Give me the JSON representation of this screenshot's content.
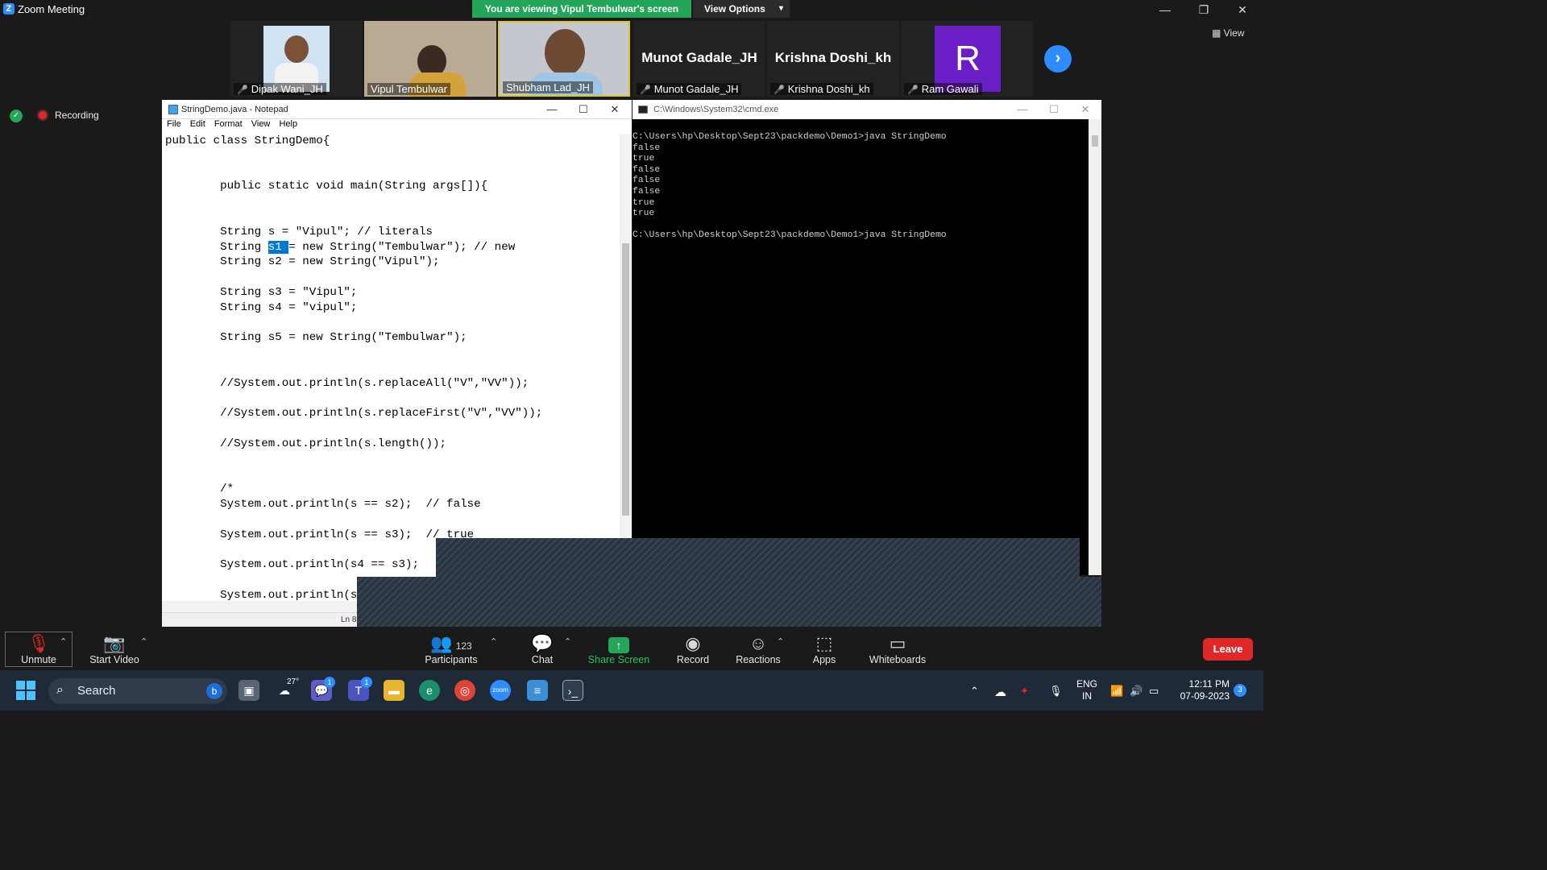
{
  "window": {
    "title": "Zoom Meeting",
    "banner": "You are viewing Vipul Tembulwar's screen",
    "view_options": "View Options",
    "view_btn": "View"
  },
  "participants_strip": [
    {
      "name": "Dipak Wani_JH",
      "muted": true
    },
    {
      "name": "Vipul Tembulwar",
      "muted": false
    },
    {
      "name": "Shubham Lad_JH",
      "muted": false
    },
    {
      "name": "Munot Gadale_JH",
      "muted": true
    },
    {
      "name": "Krishna Doshi_kh",
      "muted": true
    },
    {
      "name": "Ram Gawali",
      "muted": true,
      "initial": "R"
    }
  ],
  "recording": {
    "label": "Recording"
  },
  "notepad": {
    "title": "StringDemo.java - Notepad",
    "menu": [
      "File",
      "Edit",
      "Format",
      "View",
      "Help"
    ],
    "status": "Ln 8"
  },
  "cmd": {
    "title": "C:\\Windows\\System32\\cmd.exe",
    "lines": [
      "C:\\Users\\hp\\Desktop\\Sept23\\packdemo\\Demo1>java StringDemo",
      "false",
      "true",
      "false",
      "false",
      "false",
      "true",
      "true",
      "",
      "C:\\Users\\hp\\Desktop\\Sept23\\packdemo\\Demo1>java StringDemo"
    ]
  },
  "toolbar": {
    "unmute": "Unmute",
    "start_video": "Start Video",
    "participants": "Participants",
    "participants_count": "123",
    "chat": "Chat",
    "share_screen": "Share Screen",
    "record": "Record",
    "reactions": "Reactions",
    "apps": "Apps",
    "whiteboards": "Whiteboards",
    "leave": "Leave"
  },
  "taskbar": {
    "search": "Search",
    "weather": "27°",
    "lang1": "ENG",
    "lang2": "IN",
    "time": "12:11 PM",
    "date": "07-09-2023",
    "notifications": "3"
  }
}
